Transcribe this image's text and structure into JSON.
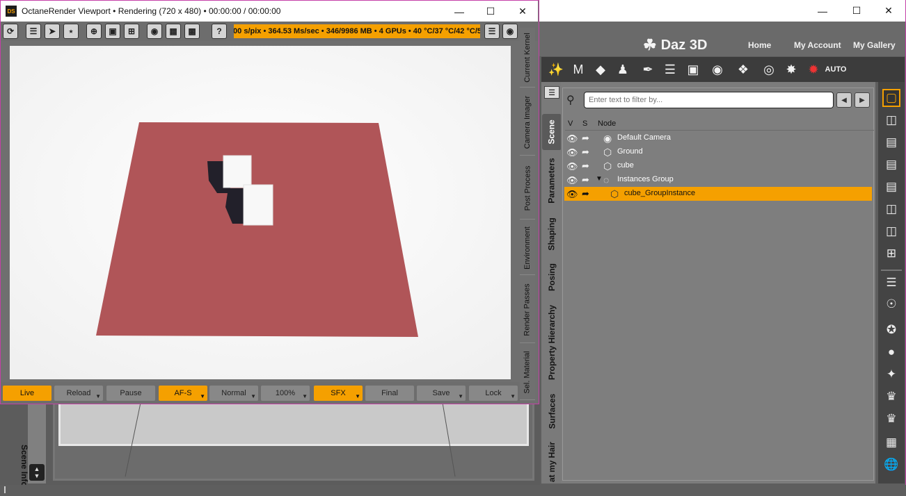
{
  "octane": {
    "app_icon": "DS",
    "title": "OctaneRender Viewport • Rendering (720 x 480) • 00:00:00 / 00:00:00",
    "status": "00 s/pix • 364.53 Ms/sec • 346/9986 MB • 4 GPUs • 40 °C/37 °C/42 °C/5",
    "toolbar_icons": [
      "refresh-icon",
      "list-indent-icon",
      "load-icon",
      "network-icon",
      "target-icon",
      "focus-frame-icon",
      "grid-4-icon",
      "circle-icon",
      "grid-icon",
      "image-icon",
      "help-icon",
      "list-icon",
      "camera-icon"
    ],
    "side_tabs": [
      "Current Kernel",
      "Camera Imager",
      "Post Process",
      "Environment",
      "Render Passes",
      "Sel. Material"
    ],
    "bottom_buttons": [
      {
        "label": "Live",
        "on": true
      },
      {
        "label": "Reload",
        "on": false
      },
      {
        "label": "Pause",
        "on": false
      },
      {
        "label": "AF-S",
        "on": true
      },
      {
        "label": "Normal",
        "on": false
      },
      {
        "label": "100%",
        "on": false
      },
      {
        "label": "SFX",
        "on": true
      },
      {
        "label": "Final",
        "on": false
      },
      {
        "label": "Save",
        "on": false
      },
      {
        "label": "Lock",
        "on": false
      }
    ],
    "render": {
      "plane_color": "#b05558",
      "cube_color": "#f8f8f8",
      "shadow_color": "#22202a"
    }
  },
  "daz": {
    "logo": "Daz 3D",
    "nav": [
      "Home",
      "My Account",
      "My Gallery"
    ],
    "left_tab": "Scene Info",
    "side_tabs": [
      "Scene",
      "Parameters",
      "Shaping",
      "Posing",
      "Property Hierarchy",
      "Surfaces",
      "at my Hair"
    ],
    "filter_placeholder": "Enter text to filter by...",
    "columns": {
      "v": "V",
      "s": "S",
      "node": "Node"
    },
    "nodes": [
      {
        "label": "Default Camera",
        "icon": "camera-node-icon",
        "depth": 0,
        "selected": false
      },
      {
        "label": "Ground",
        "icon": "cube-node-icon",
        "depth": 0,
        "selected": false
      },
      {
        "label": "cube",
        "icon": "cube-node-icon",
        "depth": 0,
        "selected": false
      },
      {
        "label": "Instances Group",
        "icon": "group-node-icon",
        "depth": 0,
        "selected": false,
        "expanded": true
      },
      {
        "label": "cube_GroupInstance",
        "icon": "instance-node-icon",
        "depth": 1,
        "selected": true
      }
    ],
    "accent": "#f5a000"
  }
}
